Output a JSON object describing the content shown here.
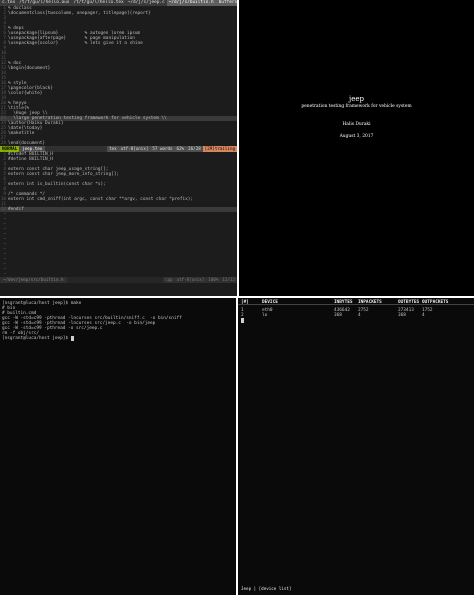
{
  "vim": {
    "tabs": [
      {
        "label": "c.tex",
        "active": false
      },
      {
        "label": "/t/t/gu/l/hello.aux",
        "active": false
      },
      {
        "label": "/t/t/gu/l/hello.tex",
        "active": false
      },
      {
        "label": "~/d/j/s/jeep.c",
        "active": false
      },
      {
        "label": "~/d/j/s/builtin.h",
        "active": true
      }
    ],
    "buffers_label": "buffers",
    "lines_top": [
      {
        "n": "1",
        "text": "% doclass"
      },
      {
        "n": "2",
        "text": "\\documentclass[twocolumn, onepager, titlepage]{report}"
      },
      {
        "n": "3",
        "text": ""
      },
      {
        "n": "4",
        "text": ""
      },
      {
        "n": "5",
        "text": "% deps"
      },
      {
        "n": "6",
        "text": "\\usepackage{lipsum}          % autogen lorem ipsum"
      },
      {
        "n": "7",
        "text": "\\usepackage{afterpage}       % page manipulation"
      },
      {
        "n": "8",
        "text": "\\usepackage{xcolor}          % lets give it a shine"
      },
      {
        "n": "9",
        "text": ""
      },
      {
        "n": "10",
        "text": ""
      },
      {
        "n": "11",
        "text": ""
      },
      {
        "n": "12",
        "text": "% doc"
      },
      {
        "n": "13",
        "text": "\\begin{document}"
      },
      {
        "n": "14",
        "text": ""
      },
      {
        "n": "15",
        "text": ""
      },
      {
        "n": "16",
        "text": "% style"
      },
      {
        "n": "17",
        "text": "\\pagecolor{black}"
      },
      {
        "n": "18",
        "text": "\\color{white}"
      },
      {
        "n": "19",
        "text": ""
      },
      {
        "n": "20",
        "text": "% heyyo"
      },
      {
        "n": "21",
        "text": "\\title{%"
      },
      {
        "n": "22",
        "text": "  \\Huge jeep \\\\"
      },
      {
        "n": "23",
        "text": "  \\large penetration testing framework for vehicle system \\\\"
      },
      {
        "n": "24",
        "text": "\\author{Haiku Duraki}"
      },
      {
        "n": "25",
        "text": "\\date{\\today}"
      },
      {
        "n": "26",
        "text": "\\maketitle"
      },
      {
        "n": "27",
        "text": ""
      },
      {
        "n": "28",
        "text": "\\end{document}"
      }
    ],
    "status_top": {
      "mode": "NORMAL",
      "fname": "jeep.tex",
      "ftype": "tex",
      "encoding": "utf-8[unix]",
      "words": "57 words",
      "pct": "62%",
      "pos": "26/28",
      "warn": "[29]trailing"
    },
    "lines_bottom": [
      {
        "n": "1",
        "text": "#ifndef BUILTIN_H"
      },
      {
        "n": "2",
        "text": "#define BUILTIN_H"
      },
      {
        "n": "3",
        "text": ""
      },
      {
        "n": "4",
        "text": "extern const char jeep_usage_string[];"
      },
      {
        "n": "5",
        "text": "extern const char jeep_more_info_string[];"
      },
      {
        "n": "6",
        "text": ""
      },
      {
        "n": "7",
        "text": "extern int is_builtin(const char *s);"
      },
      {
        "n": "8",
        "text": ""
      },
      {
        "n": "9",
        "text": "/* commands */"
      },
      {
        "n": "10",
        "text": "extern int cmd_sniff(int argc, const char **argv, const char *prefix);"
      },
      {
        "n": "11",
        "text": ""
      },
      {
        "n": "12",
        "text": "#endif"
      }
    ],
    "tilde_count": 13,
    "status_bottom": {
      "fname": "~/dev/jeep/src/builtin.h",
      "ftype": "cpp",
      "encoding": "utf-8[unix]",
      "pct": "100%",
      "pos": "12/12"
    }
  },
  "pdf": {
    "title": "jeep",
    "subtitle": "penetration testing framework for vehicle system",
    "author": "Halis Duraki",
    "date": "August 3, 2017"
  },
  "shell": {
    "lines": [
      "[nsgrant@luca/host jeep]$ make",
      "# bin",
      "# builtin.cmd",
      "gcc -W -std=c99 -pthread -lncurses src/builtin/sniff.c  -o bin/sniff",
      "gcc -W -std=c99 -pthread -lncurses src/jeep.c  -o bin/jeep",
      "gcc -W -std=c99 -pthread -o src/jeep.c",
      "rm -f obj/src/",
      "[nsgrant@luca/host jeep]$ "
    ]
  },
  "jeep": {
    "columns": [
      "[#]",
      "DEVICE",
      "INBYTES",
      "INPACKETS",
      "OUTBYTES",
      "OUTPACKETS"
    ],
    "rows": [
      [
        "1",
        "eth0",
        "436642",
        "2752",
        "273413",
        "1752"
      ],
      [
        "2",
        "lo",
        "368",
        "4",
        "368",
        "4"
      ]
    ],
    "status_label": "Jeep | [device list]"
  },
  "colors": {
    "statusline_mode": "#87af00",
    "statusline_warn": "#d7875f",
    "editor_bg": "#1c1c1c",
    "pdf_bg": "#000000"
  }
}
